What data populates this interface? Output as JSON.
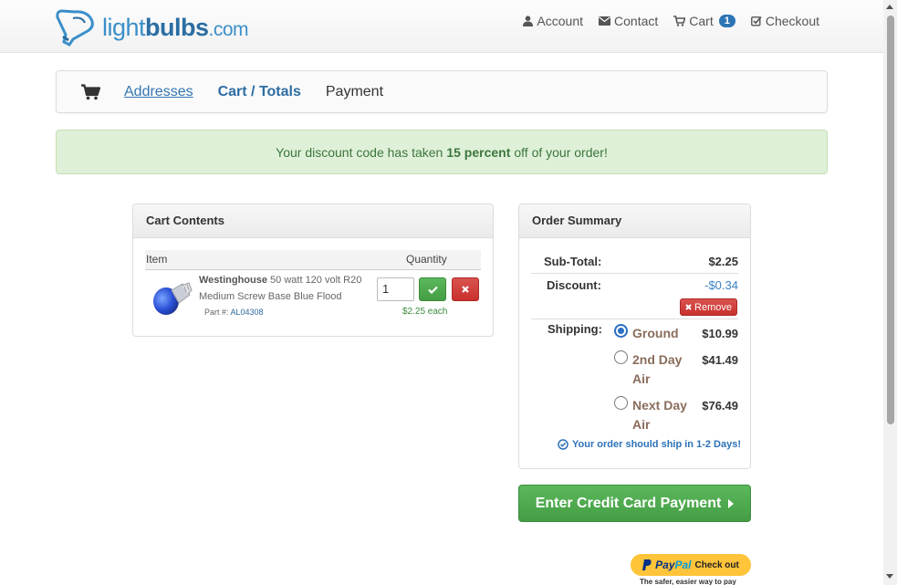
{
  "logo": {
    "part1": "light",
    "part2": "bulbs",
    "part3": ".com"
  },
  "topnav": {
    "account": "Account",
    "contact": "Contact",
    "cart": "Cart",
    "cart_count": "1",
    "checkout": "Checkout"
  },
  "steps": {
    "addresses": "Addresses",
    "cart_totals": "Cart / Totals",
    "payment": "Payment"
  },
  "alert": {
    "before": "Your discount code has taken",
    "bold": "15 percent",
    "after": "off of your order!"
  },
  "cart": {
    "title": "Cart Contents",
    "col_item": "Item",
    "col_quantity": "Quantity",
    "product_brand": "Westinghouse",
    "product_desc": "50 watt 120 volt R20 Medium Screw Base Blue Flood",
    "part_label": "Part #:",
    "part_number": "AL04308",
    "quantity": "1",
    "each_price": "$2.25 each"
  },
  "summary": {
    "title": "Order Summary",
    "subtotal_label": "Sub-Total:",
    "subtotal": "$2.25",
    "discount_label": "Discount:",
    "discount": "-$0.34",
    "remove_label": "Remove",
    "shipping_label": "Shipping:",
    "options": [
      {
        "line1": "Ground",
        "line2": "",
        "price": "$10.99",
        "selected": true
      },
      {
        "line1": "2nd Day",
        "line2": "Air",
        "price": "$41.49",
        "selected": false
      },
      {
        "line1": "Next Day",
        "line2": "Air",
        "price": "$76.49",
        "selected": false
      }
    ],
    "ship_note": "Your order should ship in 1-2 Days!"
  },
  "pay_button": "Enter Credit Card Payment",
  "paypal": {
    "pay": "Pay",
    "pal": "Pal",
    "checkout": "Check out",
    "tagline": "The safer, easier way to pay"
  },
  "colors": {
    "accent": "#2c74b4",
    "success": "#5cb85c",
    "danger": "#d9534f",
    "alert_bg": "#dff0d8"
  }
}
